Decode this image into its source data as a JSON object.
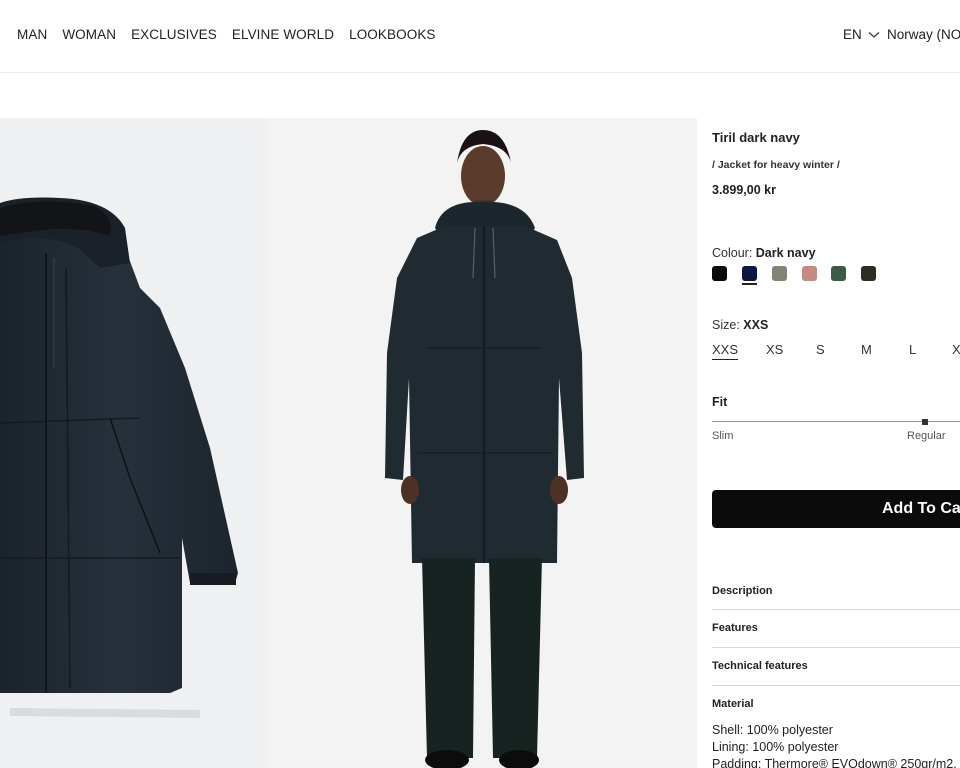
{
  "nav": {
    "items": [
      "MAN",
      "WOMAN",
      "EXCLUSIVES",
      "ELVINE WORLD",
      "LOOKBOOKS"
    ],
    "language": "EN",
    "country": "Norway (NOK"
  },
  "product": {
    "name": "Tiril dark navy",
    "subtitle": "/ Jacket for heavy winter /",
    "price": "3.899,00 kr"
  },
  "colour": {
    "label": "Colour:",
    "selected": "Dark navy",
    "swatches": [
      {
        "name": "black",
        "hex": "#0a0a0a"
      },
      {
        "name": "dark navy",
        "hex": "#0e1640"
      },
      {
        "name": "olive grey",
        "hex": "#7f8572"
      },
      {
        "name": "dusty pink",
        "hex": "#c48a80"
      },
      {
        "name": "green",
        "hex": "#3d5a45"
      },
      {
        "name": "dark olive",
        "hex": "#2a2f22"
      }
    ]
  },
  "size": {
    "label": "Size:",
    "selected": "XXS",
    "options": [
      "XXS",
      "XS",
      "S",
      "M",
      "L",
      "X"
    ]
  },
  "fit": {
    "label": "Fit",
    "min_label": "Slim",
    "max_label": "Regular",
    "value": 0.86
  },
  "cart": {
    "label": "Add To Car"
  },
  "accordion": {
    "description": "Description",
    "features": "Features",
    "technical": "Technical features",
    "material": "Material"
  },
  "material": {
    "lines": [
      "Shell: 100% polyester",
      "Lining: 100% polyester",
      "Padding: Thermore® EVOdown® 250gr/m2,"
    ]
  },
  "colors": {
    "jacket": "#1e2730",
    "image_bg_left": "#eef0f1",
    "image_bg_right": "#f3f3f3"
  }
}
